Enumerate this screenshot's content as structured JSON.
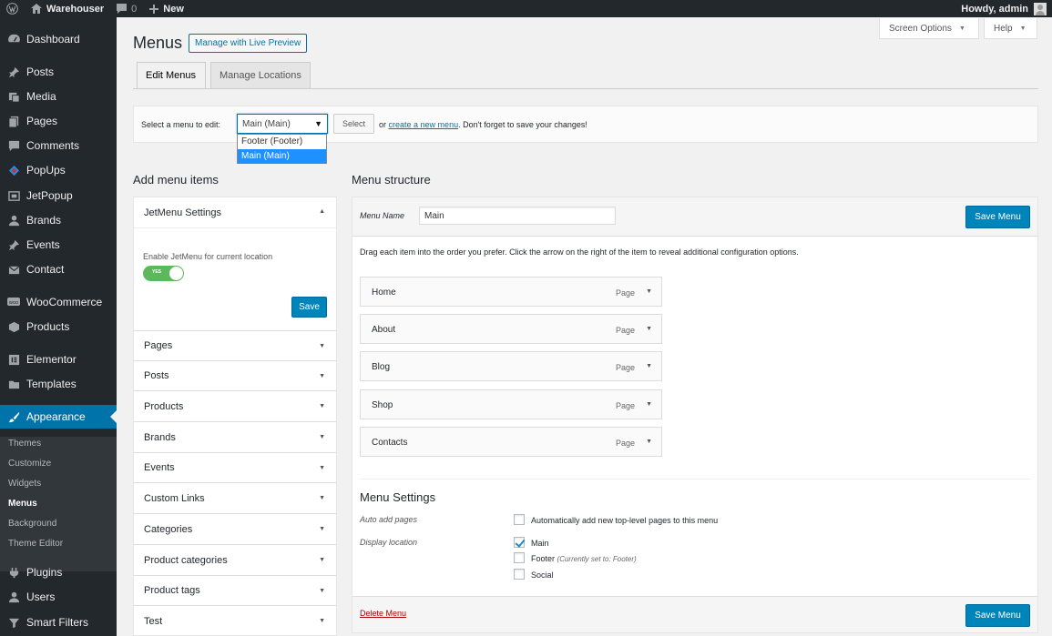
{
  "adminbar": {
    "site_name": "Warehouser",
    "comments_count": "0",
    "new_label": "New",
    "greeting": "Howdy, admin"
  },
  "sidebar": {
    "items": [
      {
        "label": "Dashboard",
        "icon": "dashboard-icon"
      },
      {
        "label": "Posts",
        "icon": "pin-icon"
      },
      {
        "label": "Media",
        "icon": "media-icon"
      },
      {
        "label": "Pages",
        "icon": "pages-icon"
      },
      {
        "label": "Comments",
        "icon": "comment-icon"
      },
      {
        "label": "PopUps",
        "icon": "popup-icon"
      },
      {
        "label": "JetPopup",
        "icon": "jetpopup-icon"
      },
      {
        "label": "Brands",
        "icon": "user-icon"
      },
      {
        "label": "Events",
        "icon": "pin-icon"
      },
      {
        "label": "Contact",
        "icon": "mail-icon"
      },
      {
        "label": "WooCommerce",
        "icon": "woo-icon"
      },
      {
        "label": "Products",
        "icon": "box-icon"
      },
      {
        "label": "Elementor",
        "icon": "elementor-icon"
      },
      {
        "label": "Templates",
        "icon": "folder-icon"
      },
      {
        "label": "Appearance",
        "icon": "brush-icon"
      },
      {
        "label": "Plugins",
        "icon": "plug-icon"
      },
      {
        "label": "Users",
        "icon": "user-icon"
      },
      {
        "label": "Smart Filters",
        "icon": "filter-icon"
      }
    ],
    "appearance_sub": [
      "Themes",
      "Customize",
      "Widgets",
      "Menus",
      "Background",
      "Theme Editor"
    ]
  },
  "screen_options_label": "Screen Options",
  "help_label": "Help",
  "page_title": "Menus",
  "live_preview_label": "Manage with Live Preview",
  "tabs": [
    "Edit Menus",
    "Manage Locations"
  ],
  "manage": {
    "label": "Select a menu to edit:",
    "selected": "Main (Main)",
    "select_button": "Select",
    "or_text": "or",
    "create_link": "create a new menu",
    "after_text": ". Don't forget to save your changes!",
    "options": [
      "Footer (Footer)",
      "Main (Main)"
    ]
  },
  "add_items": {
    "title": "Add menu items",
    "jetmenu_title": "JetMenu Settings",
    "jetmenu_label": "Enable JetMenu for current location",
    "toggle_text": "YES",
    "toggle_on": true,
    "save_label": "Save",
    "sections": [
      "Pages",
      "Posts",
      "Products",
      "Brands",
      "Events",
      "Custom Links",
      "Categories",
      "Product categories",
      "Product tags",
      "Test"
    ]
  },
  "structure": {
    "title": "Menu structure",
    "menu_name_label": "Menu Name",
    "menu_name_value": "Main",
    "save_menu_label": "Save Menu",
    "drag_text": "Drag each item into the order you prefer. Click the arrow on the right of the item to reveal additional configuration options.",
    "items": [
      {
        "title": "Home",
        "type": "Page"
      },
      {
        "title": "About",
        "type": "Page"
      },
      {
        "title": "Blog",
        "type": "Page"
      },
      {
        "title": "Shop",
        "type": "Page"
      },
      {
        "title": "Contacts",
        "type": "Page"
      }
    ],
    "settings_title": "Menu Settings",
    "auto_add_label": "Auto add pages",
    "auto_add_text": "Automatically add new top-level pages to this menu",
    "auto_add_checked": false,
    "display_location_label": "Display location",
    "locations": [
      {
        "name": "Main",
        "note": "",
        "checked": true
      },
      {
        "name": "Footer",
        "note": "(Currently set to: Footer)",
        "checked": false
      },
      {
        "name": "Social",
        "note": "",
        "checked": false
      }
    ],
    "delete_label": "Delete Menu"
  },
  "colors": {
    "admin_dark": "#23282d",
    "accent": "#0073aa",
    "primary_button": "#0085ba",
    "toggle_on": "#5cb85c",
    "delete": "#a00000"
  }
}
